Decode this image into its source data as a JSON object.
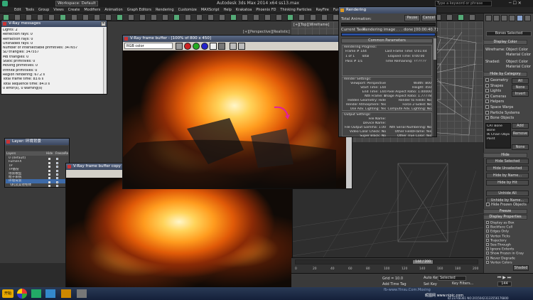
{
  "app": {
    "title": "Autodesk 3ds Max  2014 x64     ss13.max",
    "workspace": "Workspace: Default",
    "search_placeholder": "Type a keyword or phrase"
  },
  "menu": [
    "Edit",
    "Tools",
    "Group",
    "Views",
    "Create",
    "Modifiers",
    "Animation",
    "Graph Editors",
    "Rendering",
    "Customize",
    "MAXScript",
    "Help",
    "Krakatoa",
    "Phoenix FD",
    "Thinking Particles",
    "RayFire",
    "Fume FX",
    "Fracture",
    "Max Script"
  ],
  "viewport_labels": {
    "top_left": "[+][Top][Wireframe]",
    "mid": "[+][Perspective][Realistic]"
  },
  "vray_messages": {
    "title": "V-Ray messages",
    "lines": [
      "Lights: 2",
      "Reflection rays: 0",
      "Refraction rays: 0",
      "Unshaded rays: 0",
      "Number of intersectable primitives: 347657",
      "SD triangles: 347557",
      "MB triangles: 0",
      "Static primitives: 0",
      "Moving primitives: 0",
      "Infinite primitives: 0",
      "Region rendering: 67.2 s",
      "Total frame time: 83.6 s",
      "Total sequence time: 84.0 s",
      "0 error(s), 0 warning(s)"
    ]
  },
  "vfb_main": {
    "title": "V-Ray frame buffer - [100% of 800 x 450]",
    "channel": "RGB color"
  },
  "vfb_copy": {
    "title": "V-Ray frame buffer copy 1"
  },
  "layers": {
    "title": "Layer: 环境背景",
    "headers": [
      "Layers",
      "Hide",
      "Freeze",
      "Render",
      "Color",
      "Radiosity"
    ],
    "rows": [
      "0 (default)",
      "FumeFX",
      "TP",
      "TP备份",
      "场景模型",
      "粒子系统",
      "环境背景",
      "飞机及其他物体"
    ],
    "selected_index": 6
  },
  "rendering": {
    "title": "Rendering",
    "pause": "Pause",
    "cancel": "Cancel",
    "total_animation_label": "Total Animation:",
    "total_animation_progress": 0.0,
    "current_task_label": "Current Task:",
    "current_task": "Rendering image . . . done [00:00:40.7]",
    "current_task_progress": 1.0,
    "common_params_header": "Common Parameters",
    "render_progress_label": "Rendering Progress:",
    "frame_label": "Frame #",
    "frame_value": "144",
    "of_label": "1 of",
    "of_value": "1",
    "total_label": "Total",
    "pass_label": "Pass #",
    "pass_value": "1/1",
    "last_frame_time_label": "Last Frame Time:",
    "last_frame_time": "0:01:44",
    "elapsed_label": "Elapsed Time:",
    "elapsed": "0:00:00",
    "time_remaining_label": "Time Remaining:",
    "time_remaining": "??:??:??",
    "render_settings_label": "Render Settings:",
    "settings": [
      [
        "Viewport: Perspective",
        "Width: 800"
      ],
      [
        "Start Time: 144",
        "Height: 450"
      ],
      [
        "End Time: 144",
        "Pixel Aspect Ratio: 1.00000"
      ],
      [
        "Nth Frame: 1",
        "Image Aspect Ratio: 1.77778"
      ],
      [
        "Hidden Geometry: Hide",
        "Render to Fields: No"
      ],
      [
        "Render Atmosphere: Yes",
        "Force 2-Sided: No"
      ],
      [
        "Use Adv. Lighting: Yes",
        "Compute Adv. Lighting: No"
      ]
    ],
    "output_settings_label": "Output Settings:",
    "output": [
      [
        "File Name:",
        ""
      ],
      [
        "Device Name:",
        ""
      ],
      [
        "File Output Gamma: 1.00",
        "Nth Serial Numbering: No"
      ],
      [
        "Video Color Check: No",
        "Other Field/Frame: Yes"
      ],
      [
        "Super Black: No",
        "Other True Color: Yes"
      ]
    ]
  },
  "command_panel": {
    "name_field": "Bones Selected",
    "display_color_header": "Display Color",
    "wireframe_label": "Wireframe:",
    "shaded_label": "Shaded:",
    "object_color": "Object Color",
    "material_color": "Material Color",
    "hide_by_category_header": "Hide by Category",
    "categories": [
      "Geometry",
      "Shapes",
      "Lights",
      "Cameras",
      "Helpers",
      "Space Warps",
      "Particle Systems",
      "Bone Objects"
    ],
    "cat_buttons": [
      "All",
      "None",
      "Invert"
    ],
    "list_items": [
      "CAT Bone",
      "Bone",
      "IK Chain Object",
      "Point"
    ],
    "list_buttons": [
      "Add",
      "Remove",
      "None"
    ],
    "hide_header": "Hide",
    "hide_buttons": [
      "Hide Selected",
      "Hide Unselected",
      "Hide by Name...",
      "Hide by Hit",
      "Unhide All",
      "Unhide by Name..."
    ],
    "hide_frozen": "Hide Frozen Objects",
    "freeze_header": "Freeze",
    "display_props_header": "Display Properties",
    "display_props": [
      "Display as Box",
      "Backface Cull",
      "Edges Only",
      "Vertex Ticks",
      "Trajectory",
      "See-Through",
      "Ignore Extents",
      "Show Frozen in Gray",
      "Never Degrade",
      "Vertex Colors"
    ],
    "shaded_btn": "Shaded"
  },
  "timeline": {
    "frame": "144 / 200",
    "ticks": [
      "0",
      "20",
      "40",
      "60",
      "80",
      "100",
      "120",
      "140",
      "160",
      "180",
      "200"
    ],
    "progress": 0.72
  },
  "status": {
    "auto_key": "Auto Key",
    "set_key": "Set Key",
    "selected": "Selected",
    "key_filters": "Key Filters...",
    "add_time_tag": "Add Time Tag",
    "grid": "Grid = 10.0",
    "frame_field": "144"
  },
  "taskbar": {
    "start": "开始",
    "watermark": "fb-www.Yinsu.Com.Moxing",
    "site": "昵图网 www.nipic.com",
    "id": "ID:23748361 NO:20150423133556176800"
  },
  "colors": {
    "accent": "#3d6aa8",
    "vray_title": "#3b4760",
    "progress_blue": "#2a4fa0"
  }
}
